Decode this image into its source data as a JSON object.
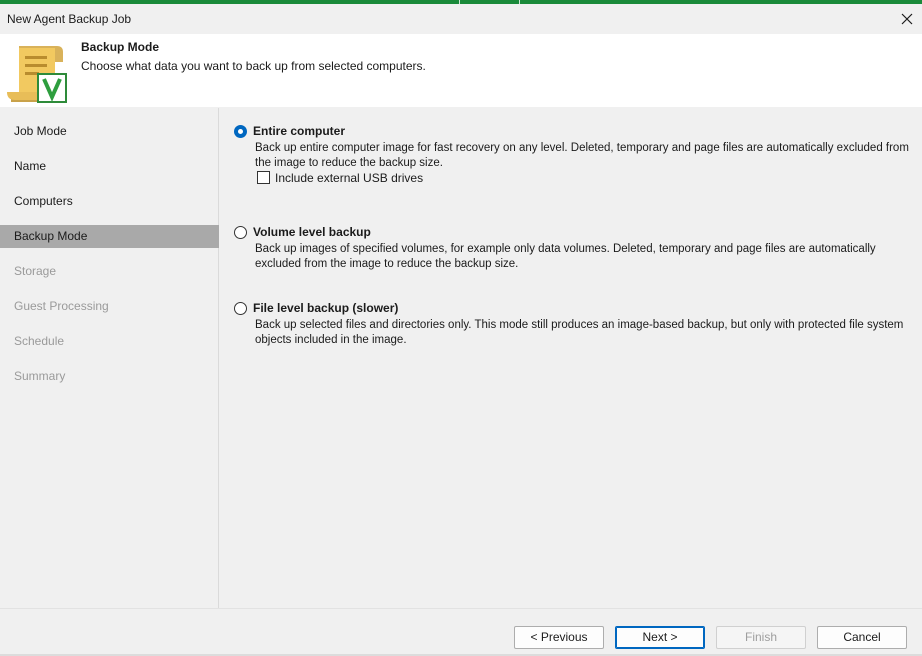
{
  "window": {
    "title": "New Agent Backup Job",
    "accent_color": "#1a8a3a"
  },
  "header": {
    "title": "Backup Mode",
    "subtitle": "Choose what data you want to back up from selected computers.",
    "icon": "backup-job-scroll-icon"
  },
  "sidebar": {
    "items": [
      {
        "label": "Job Mode",
        "state": "normal"
      },
      {
        "label": "Name",
        "state": "normal"
      },
      {
        "label": "Computers",
        "state": "normal"
      },
      {
        "label": "Backup Mode",
        "state": "active"
      },
      {
        "label": "Storage",
        "state": "disabled"
      },
      {
        "label": "Guest Processing",
        "state": "disabled"
      },
      {
        "label": "Schedule",
        "state": "disabled"
      },
      {
        "label": "Summary",
        "state": "disabled"
      }
    ]
  },
  "options": [
    {
      "label": "Entire computer",
      "selected": true,
      "description": "Back up entire computer image for fast recovery on any level. Deleted, temporary and page files are automatically excluded from the image to reduce the backup size.",
      "checkbox": {
        "label": "Include external USB drives",
        "checked": false
      }
    },
    {
      "label": "Volume level backup",
      "selected": false,
      "description": "Back up images of specified volumes, for example only data volumes. Deleted, temporary and page files are automatically excluded from the image to reduce the backup size."
    },
    {
      "label": "File level backup (slower)",
      "selected": false,
      "description": "Back up selected files and directories only. This mode still produces an image-based backup, but only with protected file system objects included in the image."
    }
  ],
  "buttons": {
    "previous": "< Previous",
    "next": "Next >",
    "finish": "Finish",
    "cancel": "Cancel"
  }
}
